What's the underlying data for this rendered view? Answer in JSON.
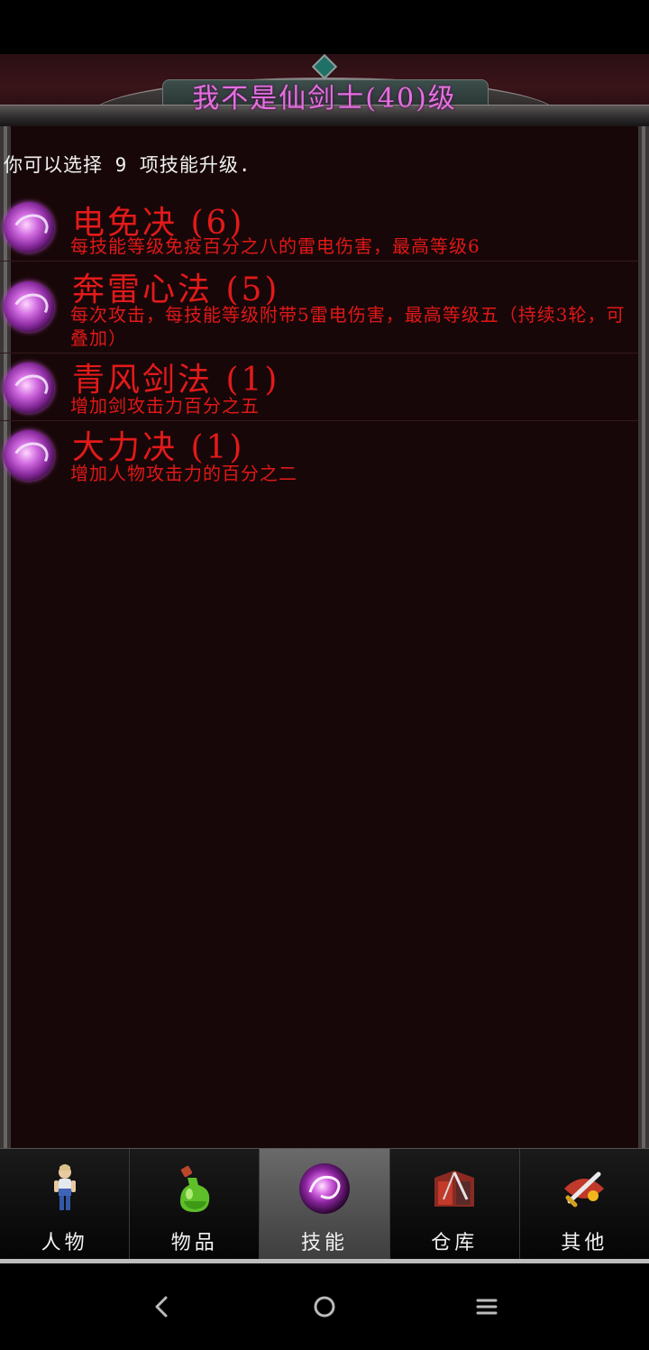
{
  "header": {
    "title": "我不是仙剑士(40)级"
  },
  "prompt": {
    "text": "你可以选择 9 项技能升级."
  },
  "skills": [
    {
      "name": "电免决 (6)",
      "desc": "每技能等级免疫百分之八的雷电伤害，最高等级6",
      "icon": "skill-orb-icon"
    },
    {
      "name": "奔雷心法 (5)",
      "desc": "每次攻击，每技能等级附带5雷电伤害，最高等级五（持续3轮，可叠加）",
      "icon": "skill-orb-icon"
    },
    {
      "name": "青风剑法 (1)",
      "desc": "增加剑攻击力百分之五",
      "icon": "skill-orb-icon"
    },
    {
      "name": "大力决 (1)",
      "desc": "增加人物攻击力的百分之二",
      "icon": "skill-orb-icon"
    }
  ],
  "tabs": [
    {
      "label": "人物",
      "icon": "character-icon",
      "active": false
    },
    {
      "label": "物品",
      "icon": "potion-icon",
      "active": false
    },
    {
      "label": "技能",
      "icon": "skill-orb-icon",
      "active": true
    },
    {
      "label": "仓库",
      "icon": "warehouse-icon",
      "active": false
    },
    {
      "label": "其他",
      "icon": "sword-icon",
      "active": false
    }
  ],
  "nav": {
    "back_icon": "back-icon",
    "home_icon": "home-icon",
    "menu_icon": "menu-icon"
  },
  "colors": {
    "title": "#e56fe0",
    "skill_text": "#e21a1a",
    "prompt_text": "#f2f2f2",
    "panel_bg": "#180708"
  }
}
